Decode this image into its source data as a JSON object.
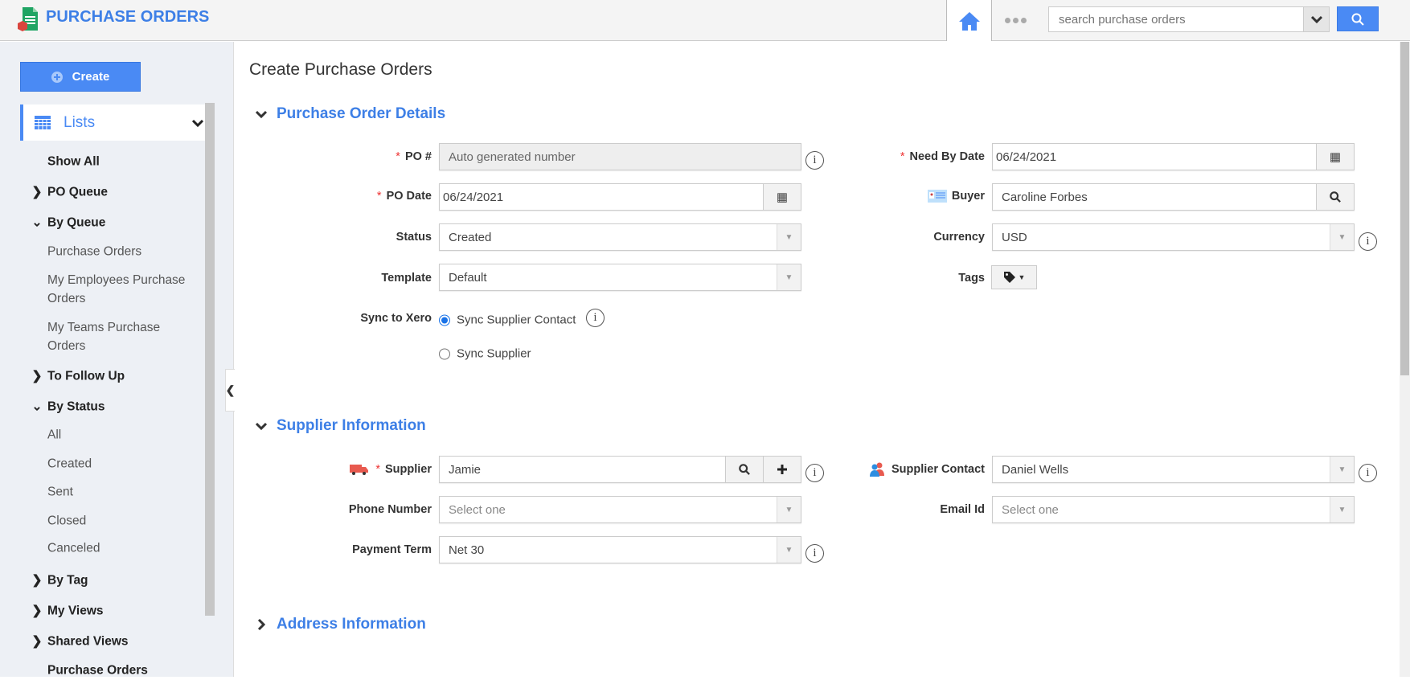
{
  "header": {
    "app_title": "PURCHASE ORDERS",
    "search_placeholder": "search purchase orders"
  },
  "sidebar": {
    "create_label": "Create",
    "lists_label": "Lists",
    "items": [
      {
        "label": "Show All",
        "type": "heading",
        "chevron": ""
      },
      {
        "label": "PO Queue",
        "type": "heading",
        "chevron": "right"
      },
      {
        "label": "By Queue",
        "type": "heading",
        "chevron": "down"
      },
      {
        "label": "Purchase Orders",
        "type": "sub"
      },
      {
        "label": "My Employees Purchase",
        "label2": "Orders",
        "type": "sub"
      },
      {
        "label": "My Teams Purchase",
        "label2": "Orders",
        "type": "sub"
      },
      {
        "label": "To Follow Up",
        "type": "heading",
        "chevron": "right"
      },
      {
        "label": "By Status",
        "type": "heading",
        "chevron": "down"
      },
      {
        "label": "All",
        "type": "sub"
      },
      {
        "label": "Created",
        "type": "sub"
      },
      {
        "label": "Sent",
        "type": "sub"
      },
      {
        "label": "Closed",
        "type": "sub"
      },
      {
        "label": "Canceled",
        "type": "sub"
      },
      {
        "label": "By Tag",
        "type": "heading",
        "chevron": "right"
      },
      {
        "label": "My Views",
        "type": "heading",
        "chevron": "right"
      },
      {
        "label": "Shared Views",
        "type": "heading",
        "chevron": "right"
      },
      {
        "label": "Purchase Orders",
        "type": "heading",
        "chevron": ""
      }
    ]
  },
  "main": {
    "title": "Create Purchase Orders",
    "sections": {
      "details": "Purchase Order Details",
      "supplier": "Supplier Information",
      "address": "Address Information"
    },
    "details": {
      "po_number": {
        "label": "PO #",
        "value": "Auto generated number"
      },
      "po_date": {
        "label": "PO Date",
        "value": "06/24/2021"
      },
      "status": {
        "label": "Status",
        "value": "Created"
      },
      "template": {
        "label": "Template",
        "value": "Default"
      },
      "sync": {
        "label": "Sync to Xero",
        "options": [
          "Sync Supplier Contact",
          "Sync Supplier"
        ],
        "selected": "Sync Supplier Contact"
      },
      "need_by_date": {
        "label": "Need By Date",
        "value": "06/24/2021"
      },
      "buyer": {
        "label": "Buyer",
        "value": "Caroline Forbes"
      },
      "currency": {
        "label": "Currency",
        "value": "USD"
      },
      "tags": {
        "label": "Tags"
      }
    },
    "supplier": {
      "supplier": {
        "label": "Supplier",
        "value": "Jamie"
      },
      "phone": {
        "label": "Phone Number",
        "placeholder": "Select one"
      },
      "payment_term": {
        "label": "Payment Term",
        "value": "Net 30"
      },
      "contact": {
        "label": "Supplier Contact",
        "value": "Daniel Wells"
      },
      "email": {
        "label": "Email Id",
        "placeholder": "Select one"
      }
    }
  },
  "colors": {
    "accent": "#4a8af4",
    "heading": "#3d7fe6",
    "required": "#e33333"
  }
}
